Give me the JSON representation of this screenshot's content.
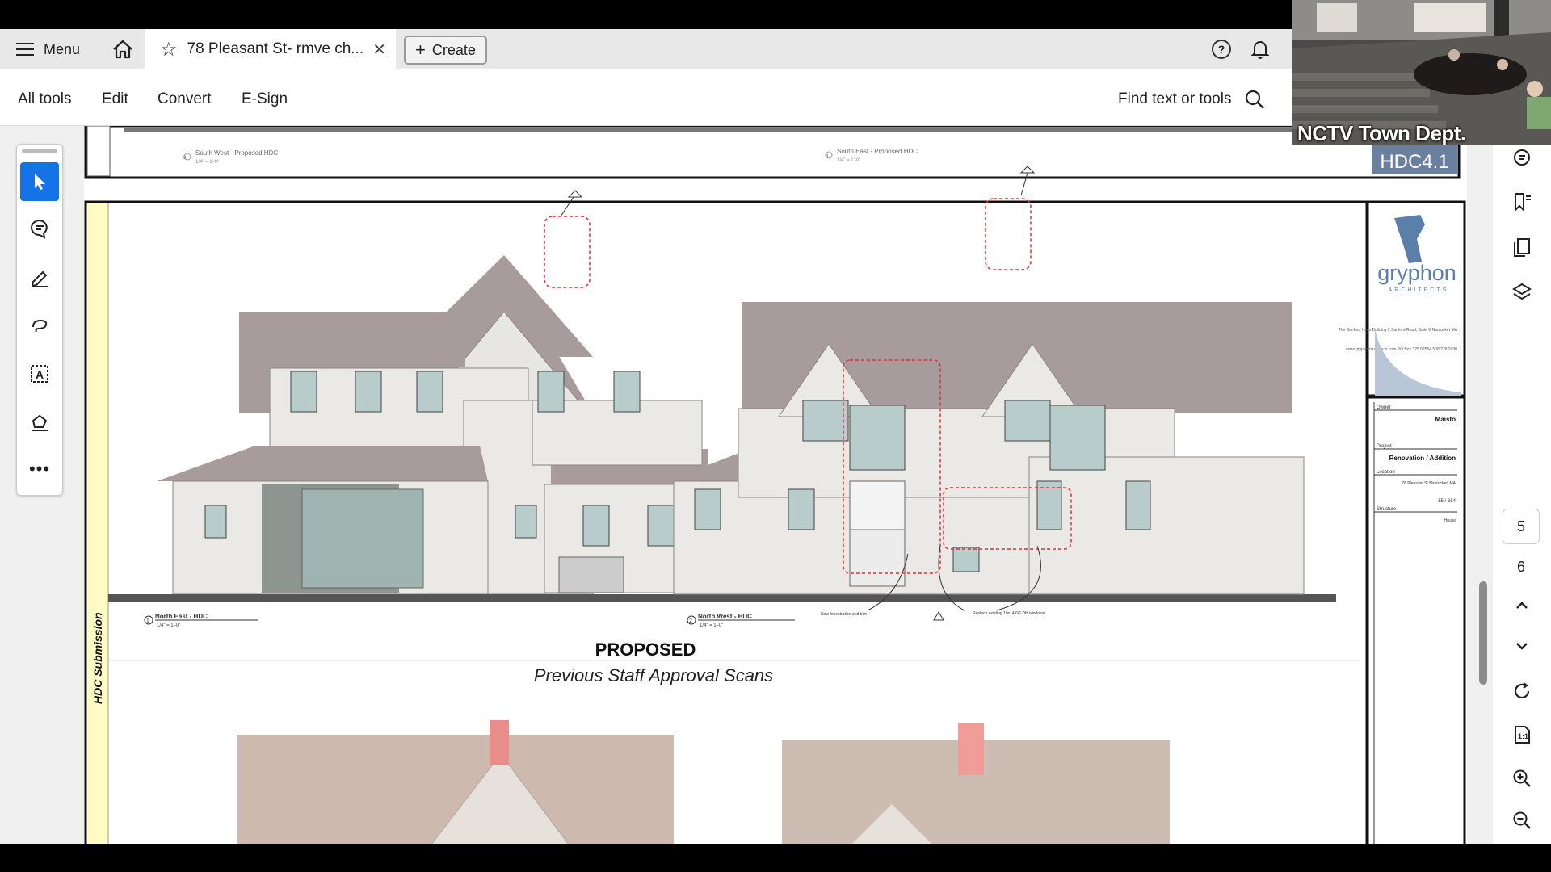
{
  "tabbar": {
    "menu_label": "Menu",
    "doc_tab_title": "78 Pleasant St- rmve ch...",
    "create_label": "Create"
  },
  "toolsbar": {
    "all_tools": "All tools",
    "edit": "Edit",
    "convert": "Convert",
    "esign": "E-Sign",
    "find_label": "Find text or tools"
  },
  "webcam": {
    "caption": "NCTV Town Dept."
  },
  "pagination": {
    "current_page": "5",
    "next_page": "6"
  },
  "drawing": {
    "sheet_number": "HDC4.1",
    "top_view_left": "South West - Proposed HDC",
    "top_view_left_num": "3",
    "top_view_right": "South East - Proposed HDC",
    "top_view_right_num": "4",
    "top_scale": "1/4\" = 1'-0\"",
    "side_label": "HDC Submission",
    "view1_title": "North East - HDC",
    "view1_num": "1",
    "view1_scale": "1/4\" = 1'-0\"",
    "view2_title": "North West - HDC",
    "view2_num": "2",
    "view2_scale": "1/4\" = 1'-0\"",
    "note_fenestration": "New fenestration and trim",
    "note_replace": "Replace existing 10x14 6/6 DH windows",
    "heading": "PROPOSED",
    "subheading": "Previous Staff Approval Scans",
    "firm_name": "gryphon",
    "firm_sub": "ARCHITECTS",
    "firm_address": "The Sanford Hoes Building 2 Sanford Road, Suite 8 Nantucket MA",
    "firm_contact": "www.gryphonarchitects.com PO Box 325 02554 508 228 2030",
    "titleblock": {
      "owner_label": "Owner",
      "owner_value": "Maisto",
      "project_label": "Project",
      "project_value": "Renovation / Addition",
      "location_label": "Location",
      "location_value": "78 Pleasant St Nantucket, MA",
      "parcel_value": "55 / 654",
      "structure_label": "Structure",
      "structure_value": "House"
    }
  }
}
